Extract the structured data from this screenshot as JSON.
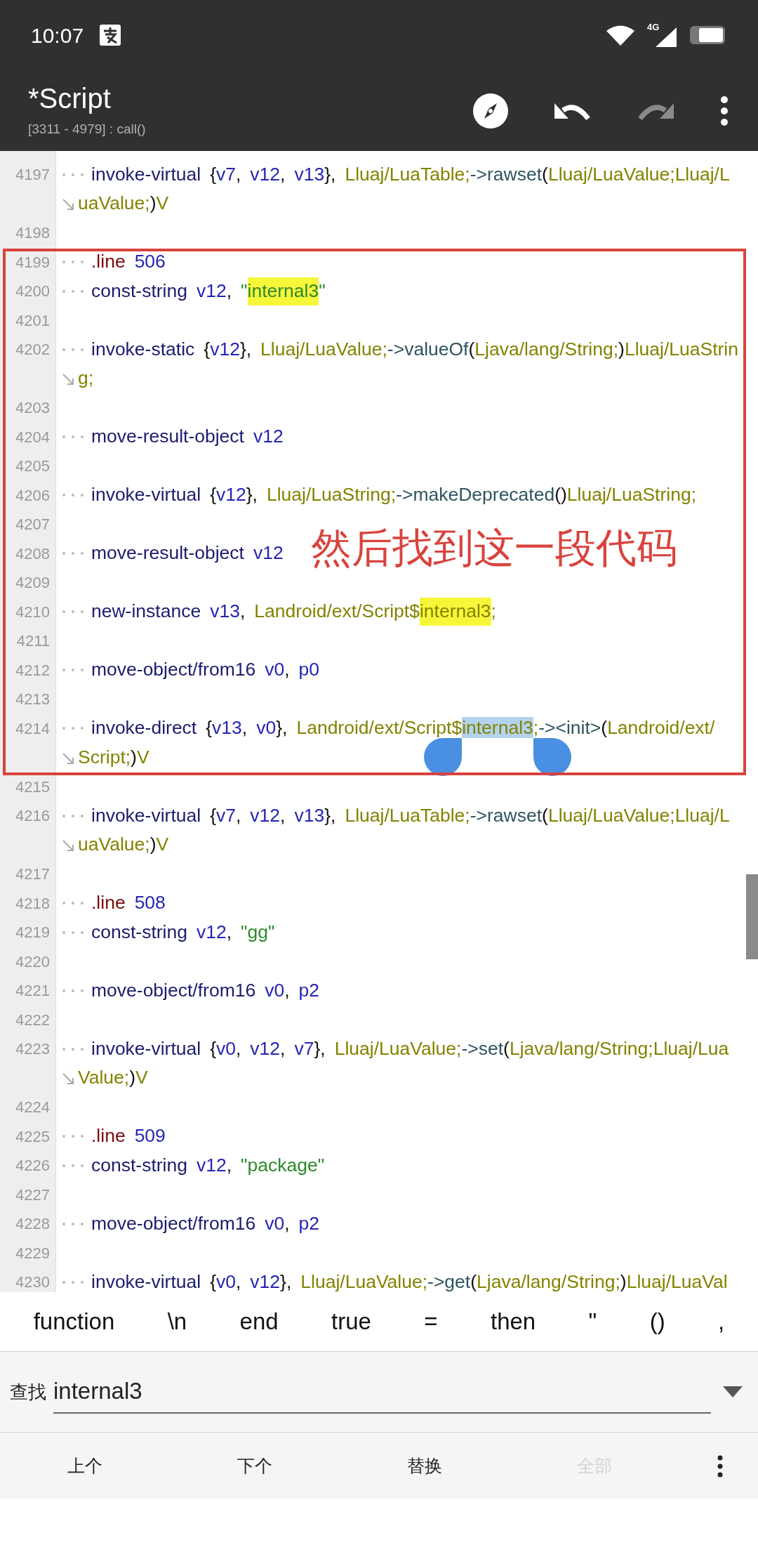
{
  "status_bar": {
    "time": "10:07",
    "network": "4G"
  },
  "toolbar": {
    "title": "*Script",
    "subtitle": "[3311 - 4979] : call()",
    "actions": [
      {
        "kind": "navigate",
        "disabled": false
      },
      {
        "kind": "undo",
        "disabled": false
      },
      {
        "kind": "redo",
        "disabled": true
      },
      {
        "kind": "more",
        "disabled": false
      }
    ]
  },
  "editor": {
    "lines": [
      {
        "number": "4197",
        "indent": true,
        "rows": [
          {
            "tokens": [
              {
                "kind": "op",
                "text": "invoke-virtual"
              },
              {
                "kind": "punct",
                "text": "{",
                "spaced": true
              },
              {
                "kind": "reg",
                "text": "v7"
              },
              {
                "kind": "punct",
                "text": ","
              },
              {
                "kind": "reg",
                "text": "v12",
                "spaced": true
              },
              {
                "kind": "punct",
                "text": ","
              },
              {
                "kind": "reg",
                "text": "v13",
                "spaced": true
              },
              {
                "kind": "punct",
                "text": "},"
              },
              {
                "kind": "type",
                "text": "Lluaj/LuaTable;",
                "spaced": true
              },
              {
                "kind": "method",
                "text": "->rawset"
              },
              {
                "kind": "punct",
                "text": "("
              },
              {
                "kind": "type",
                "text": "Lluaj/LuaValue;Lluaj/L"
              }
            ]
          },
          {
            "tokens": [
              {
                "kind": "type",
                "text": "uaValue;"
              },
              {
                "kind": "punct",
                "text": ")"
              },
              {
                "kind": "type",
                "text": "V"
              }
            ]
          }
        ]
      },
      {
        "number": "4198"
      },
      {
        "number": "4199",
        "indent": true,
        "rows": [
          {
            "tokens": [
              {
                "kind": "directive",
                "text": ".line"
              },
              {
                "kind": "num",
                "text": "506",
                "spaced": true
              }
            ]
          }
        ]
      },
      {
        "number": "4200",
        "indent": true,
        "rows": [
          {
            "tokens": [
              {
                "kind": "op",
                "text": "const-string"
              },
              {
                "kind": "reg",
                "text": "v12",
                "spaced": true
              },
              {
                "kind": "punct",
                "text": ","
              },
              {
                "kind": "str",
                "text": "\"",
                "spaced": true
              },
              {
                "kind": "str",
                "text": "internal3",
                "matched": true
              },
              {
                "kind": "str",
                "text": "\""
              }
            ]
          }
        ]
      },
      {
        "number": "4201"
      },
      {
        "number": "4202",
        "indent": true,
        "rows": [
          {
            "tokens": [
              {
                "kind": "op",
                "text": "invoke-static"
              },
              {
                "kind": "punct",
                "text": "{",
                "spaced": true
              },
              {
                "kind": "reg",
                "text": "v12"
              },
              {
                "kind": "punct",
                "text": "},"
              },
              {
                "kind": "type",
                "text": "Lluaj/LuaValue;",
                "spaced": true
              },
              {
                "kind": "method",
                "text": "->valueOf"
              },
              {
                "kind": "punct",
                "text": "("
              },
              {
                "kind": "type",
                "text": "Ljava/lang/String;"
              },
              {
                "kind": "punct",
                "text": ")"
              },
              {
                "kind": "type",
                "text": "Lluaj/LuaStrin"
              }
            ]
          },
          {
            "tokens": [
              {
                "kind": "type",
                "text": "g;"
              }
            ]
          }
        ]
      },
      {
        "number": "4203"
      },
      {
        "number": "4204",
        "indent": true,
        "rows": [
          {
            "tokens": [
              {
                "kind": "op",
                "text": "move-result-object"
              },
              {
                "kind": "reg",
                "text": "v12",
                "spaced": true
              }
            ]
          }
        ]
      },
      {
        "number": "4205"
      },
      {
        "number": "4206",
        "indent": true,
        "rows": [
          {
            "tokens": [
              {
                "kind": "op",
                "text": "invoke-virtual"
              },
              {
                "kind": "punct",
                "text": "{",
                "spaced": true
              },
              {
                "kind": "reg",
                "text": "v12"
              },
              {
                "kind": "punct",
                "text": "},"
              },
              {
                "kind": "type",
                "text": "Lluaj/LuaString;",
                "spaced": true
              },
              {
                "kind": "method",
                "text": "->makeDeprecated"
              },
              {
                "kind": "punct",
                "text": "()"
              },
              {
                "kind": "type",
                "text": "Lluaj/LuaString;"
              }
            ]
          }
        ]
      },
      {
        "number": "4207"
      },
      {
        "number": "4208",
        "indent": true,
        "rows": [
          {
            "tokens": [
              {
                "kind": "op",
                "text": "move-result-object"
              },
              {
                "kind": "reg",
                "text": "v12",
                "spaced": true
              }
            ]
          }
        ]
      },
      {
        "number": "4209"
      },
      {
        "number": "4210",
        "indent": true,
        "rows": [
          {
            "tokens": [
              {
                "kind": "op",
                "text": "new-instance"
              },
              {
                "kind": "reg",
                "text": "v13",
                "spaced": true
              },
              {
                "kind": "punct",
                "text": ","
              },
              {
                "kind": "type",
                "text": "Landroid/ext/Script$",
                "spaced": true
              },
              {
                "kind": "type",
                "text": "internal3",
                "matched": true
              },
              {
                "kind": "type",
                "text": ";"
              }
            ]
          }
        ]
      },
      {
        "number": "4211"
      },
      {
        "number": "4212",
        "indent": true,
        "rows": [
          {
            "tokens": [
              {
                "kind": "op",
                "text": "move-object/from16"
              },
              {
                "kind": "reg",
                "text": "v0",
                "spaced": true
              },
              {
                "kind": "punct",
                "text": ","
              },
              {
                "kind": "reg",
                "text": "p0",
                "spaced": true
              }
            ]
          }
        ]
      },
      {
        "number": "4213"
      },
      {
        "number": "4214",
        "indent": true,
        "rows": [
          {
            "tokens": [
              {
                "kind": "op",
                "text": "invoke-direct"
              },
              {
                "kind": "punct",
                "text": "{",
                "spaced": true
              },
              {
                "kind": "reg",
                "text": "v13"
              },
              {
                "kind": "punct",
                "text": ","
              },
              {
                "kind": "reg",
                "text": "v0",
                "spaced": true
              },
              {
                "kind": "punct",
                "text": "},"
              },
              {
                "kind": "type",
                "text": "Landroid/ext/Script$",
                "spaced": true
              },
              {
                "kind": "type",
                "text": "internal3",
                "selected": true
              },
              {
                "kind": "type",
                "text": ";"
              },
              {
                "kind": "method",
                "text": "-><init>"
              },
              {
                "kind": "punct",
                "text": "("
              },
              {
                "kind": "type",
                "text": "Landroid/ext/"
              }
            ]
          },
          {
            "tokens": [
              {
                "kind": "type",
                "text": "Script;"
              },
              {
                "kind": "punct",
                "text": ")"
              },
              {
                "kind": "type",
                "text": "V"
              }
            ]
          }
        ]
      },
      {
        "number": "4215"
      },
      {
        "number": "4216",
        "indent": true,
        "rows": [
          {
            "tokens": [
              {
                "kind": "op",
                "text": "invoke-virtual"
              },
              {
                "kind": "punct",
                "text": "{",
                "spaced": true
              },
              {
                "kind": "reg",
                "text": "v7"
              },
              {
                "kind": "punct",
                "text": ","
              },
              {
                "kind": "reg",
                "text": "v12",
                "spaced": true
              },
              {
                "kind": "punct",
                "text": ","
              },
              {
                "kind": "reg",
                "text": "v13",
                "spaced": true
              },
              {
                "kind": "punct",
                "text": "},"
              },
              {
                "kind": "type",
                "text": "Lluaj/LuaTable;",
                "spaced": true
              },
              {
                "kind": "method",
                "text": "->rawset"
              },
              {
                "kind": "punct",
                "text": "("
              },
              {
                "kind": "type",
                "text": "Lluaj/LuaValue;Lluaj/L"
              }
            ]
          },
          {
            "tokens": [
              {
                "kind": "type",
                "text": "uaValue;"
              },
              {
                "kind": "punct",
                "text": ")"
              },
              {
                "kind": "type",
                "text": "V"
              }
            ]
          }
        ]
      },
      {
        "number": "4217"
      },
      {
        "number": "4218",
        "indent": true,
        "rows": [
          {
            "tokens": [
              {
                "kind": "directive",
                "text": ".line"
              },
              {
                "kind": "num",
                "text": "508",
                "spaced": true
              }
            ]
          }
        ]
      },
      {
        "number": "4219",
        "indent": true,
        "rows": [
          {
            "tokens": [
              {
                "kind": "op",
                "text": "const-string"
              },
              {
                "kind": "reg",
                "text": "v12",
                "spaced": true
              },
              {
                "kind": "punct",
                "text": ","
              },
              {
                "kind": "str",
                "text": "\"gg\"",
                "spaced": true
              }
            ]
          }
        ]
      },
      {
        "number": "4220"
      },
      {
        "number": "4221",
        "indent": true,
        "rows": [
          {
            "tokens": [
              {
                "kind": "op",
                "text": "move-object/from16"
              },
              {
                "kind": "reg",
                "text": "v0",
                "spaced": true
              },
              {
                "kind": "punct",
                "text": ","
              },
              {
                "kind": "reg",
                "text": "p2",
                "spaced": true
              }
            ]
          }
        ]
      },
      {
        "number": "4222"
      },
      {
        "number": "4223",
        "indent": true,
        "rows": [
          {
            "tokens": [
              {
                "kind": "op",
                "text": "invoke-virtual"
              },
              {
                "kind": "punct",
                "text": "{",
                "spaced": true
              },
              {
                "kind": "reg",
                "text": "v0"
              },
              {
                "kind": "punct",
                "text": ","
              },
              {
                "kind": "reg",
                "text": "v12",
                "spaced": true
              },
              {
                "kind": "punct",
                "text": ","
              },
              {
                "kind": "reg",
                "text": "v7",
                "spaced": true
              },
              {
                "kind": "punct",
                "text": "},"
              },
              {
                "kind": "type",
                "text": "Lluaj/LuaValue;",
                "spaced": true
              },
              {
                "kind": "method",
                "text": "->set"
              },
              {
                "kind": "punct",
                "text": "("
              },
              {
                "kind": "type",
                "text": "Ljava/lang/String;Lluaj/Lua"
              }
            ]
          },
          {
            "tokens": [
              {
                "kind": "type",
                "text": "Value;"
              },
              {
                "kind": "punct",
                "text": ")"
              },
              {
                "kind": "type",
                "text": "V"
              }
            ]
          }
        ]
      },
      {
        "number": "4224"
      },
      {
        "number": "4225",
        "indent": true,
        "rows": [
          {
            "tokens": [
              {
                "kind": "directive",
                "text": ".line"
              },
              {
                "kind": "num",
                "text": "509",
                "spaced": true
              }
            ]
          }
        ]
      },
      {
        "number": "4226",
        "indent": true,
        "rows": [
          {
            "tokens": [
              {
                "kind": "op",
                "text": "const-string"
              },
              {
                "kind": "reg",
                "text": "v12",
                "spaced": true
              },
              {
                "kind": "punct",
                "text": ","
              },
              {
                "kind": "str",
                "text": "\"package\"",
                "spaced": true
              }
            ]
          }
        ]
      },
      {
        "number": "4227"
      },
      {
        "number": "4228",
        "indent": true,
        "rows": [
          {
            "tokens": [
              {
                "kind": "op",
                "text": "move-object/from16"
              },
              {
                "kind": "reg",
                "text": "v0",
                "spaced": true
              },
              {
                "kind": "punct",
                "text": ","
              },
              {
                "kind": "reg",
                "text": "p2",
                "spaced": true
              }
            ]
          }
        ]
      },
      {
        "number": "4229"
      },
      {
        "number": "4230",
        "indent": true,
        "rows": [
          {
            "tokens": [
              {
                "kind": "op",
                "text": "invoke-virtual"
              },
              {
                "kind": "punct",
                "text": "{",
                "spaced": true
              },
              {
                "kind": "reg",
                "text": "v0"
              },
              {
                "kind": "punct",
                "text": ","
              },
              {
                "kind": "reg",
                "text": "v12",
                "spaced": true
              },
              {
                "kind": "punct",
                "text": "},"
              },
              {
                "kind": "type",
                "text": "Lluaj/LuaValue;",
                "spaced": true
              },
              {
                "kind": "method",
                "text": "->get"
              },
              {
                "kind": "punct",
                "text": "("
              },
              {
                "kind": "type",
                "text": "Ljava/lang/String;"
              },
              {
                "kind": "punct",
                "text": ")"
              },
              {
                "kind": "type",
                "text": "Lluaj/LuaVal"
              }
            ]
          }
        ]
      }
    ]
  },
  "annotation": {
    "text": "然后找到这一段代码"
  },
  "symbol_bar": {
    "keys": [
      "function",
      "\\n",
      "end",
      "true",
      "=",
      "then",
      "\"",
      "()",
      ","
    ]
  },
  "find_bar": {
    "label": "查找",
    "value": "internal3"
  },
  "actions": [
    {
      "label": "上个",
      "disabled": false
    },
    {
      "label": "下个",
      "disabled": false
    },
    {
      "label": "替换",
      "disabled": false
    },
    {
      "label": "全部",
      "disabled": true
    }
  ]
}
